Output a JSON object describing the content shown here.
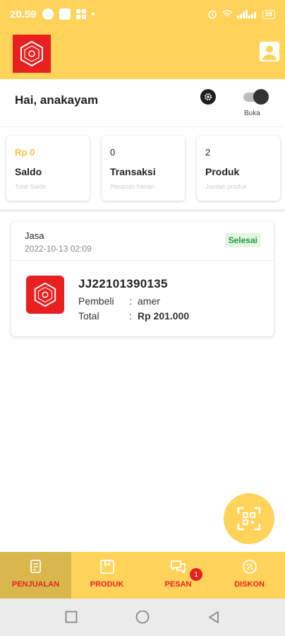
{
  "status_bar": {
    "time": "20.59",
    "battery": "58",
    "icons": [
      "messenger-icon",
      "square-icon",
      "grid-icon",
      "dot-icon",
      "alarm-icon",
      "wifi-icon",
      "signal-icon",
      "battery-icon"
    ]
  },
  "header": {
    "logo_icon": "store-logo-icon",
    "profile_icon": "profile-icon"
  },
  "greeting": {
    "text": "Hai, anakayam",
    "store_status_label": "Buka",
    "store_open": true
  },
  "stats": [
    {
      "value": "Rp 0",
      "label": "Saldo",
      "sub": "Total Saldo"
    },
    {
      "value": "0",
      "label": "Transaksi",
      "sub": "Pesanan harian"
    },
    {
      "value": "2",
      "label": "Produk",
      "sub": "Jumlah produk"
    }
  ],
  "order": {
    "type": "Jasa",
    "date": "2022-10-13 02:09",
    "status": "Selesai",
    "code": "JJ22101390135",
    "buyer_label": "Pembeli",
    "buyer_value": "amer",
    "total_label": "Total",
    "total_value": "Rp 201.000",
    "separator": ":"
  },
  "fab": {
    "icon": "qr-scan-icon"
  },
  "bottom_nav": [
    {
      "label": "PENJUALAN",
      "icon": "sales-icon",
      "active": true
    },
    {
      "label": "PRODUK",
      "icon": "product-icon",
      "active": false
    },
    {
      "label": "PESAN",
      "icon": "chat-icon",
      "active": false,
      "badge": "1"
    },
    {
      "label": "DISKON",
      "icon": "discount-icon",
      "active": false
    }
  ],
  "colors": {
    "primary": "#ffd35a",
    "accent_red": "#e8201f",
    "active_tab": "#d9b74c",
    "success": "#1d9b3a"
  }
}
